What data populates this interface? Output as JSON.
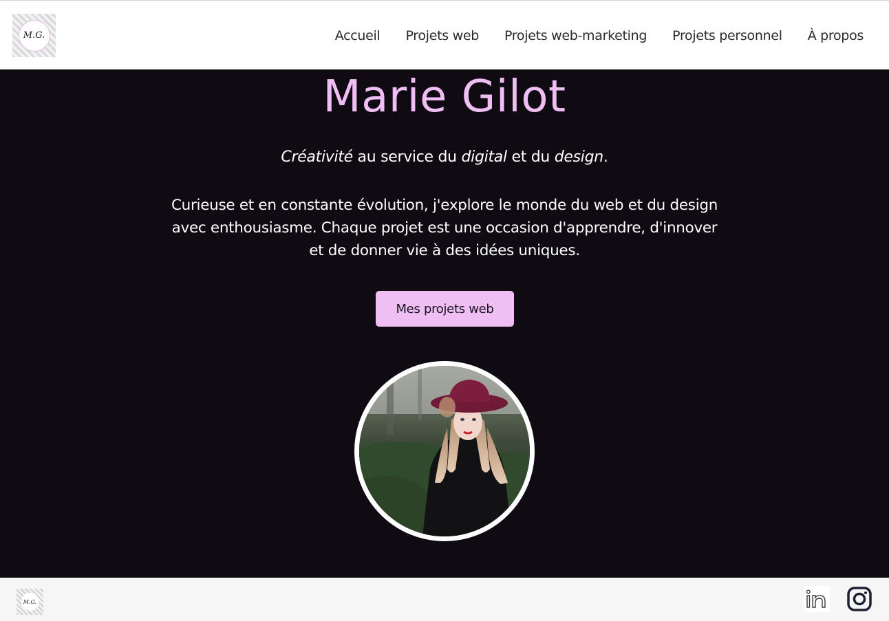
{
  "header": {
    "logo_text": "M.G.",
    "nav": [
      "Accueil",
      "Projets web",
      "Projets web-marketing",
      "Projets personnel",
      "À propos"
    ]
  },
  "hero": {
    "title": "Marie Gilot",
    "tagline": {
      "word1": "Créativité",
      "text1": " au service du ",
      "word2": "digital",
      "text2": " et du ",
      "word3": "design",
      "text3": "."
    },
    "intro": "Curieuse et en constante évolution, j'explore le monde du web et du design avec enthousiasme. Chaque projet est une occasion d'apprendre, d'innover et de donner vie à des idées uniques.",
    "cta_label": "Mes projets web"
  },
  "footer": {
    "logo_text": "M.G.",
    "social": [
      "linkedin-icon",
      "instagram-icon"
    ]
  },
  "colors": {
    "accent": "#efbff4",
    "background": "#100b13",
    "header_bg": "#ffffff",
    "footer_bg": "#f6f6f6"
  }
}
